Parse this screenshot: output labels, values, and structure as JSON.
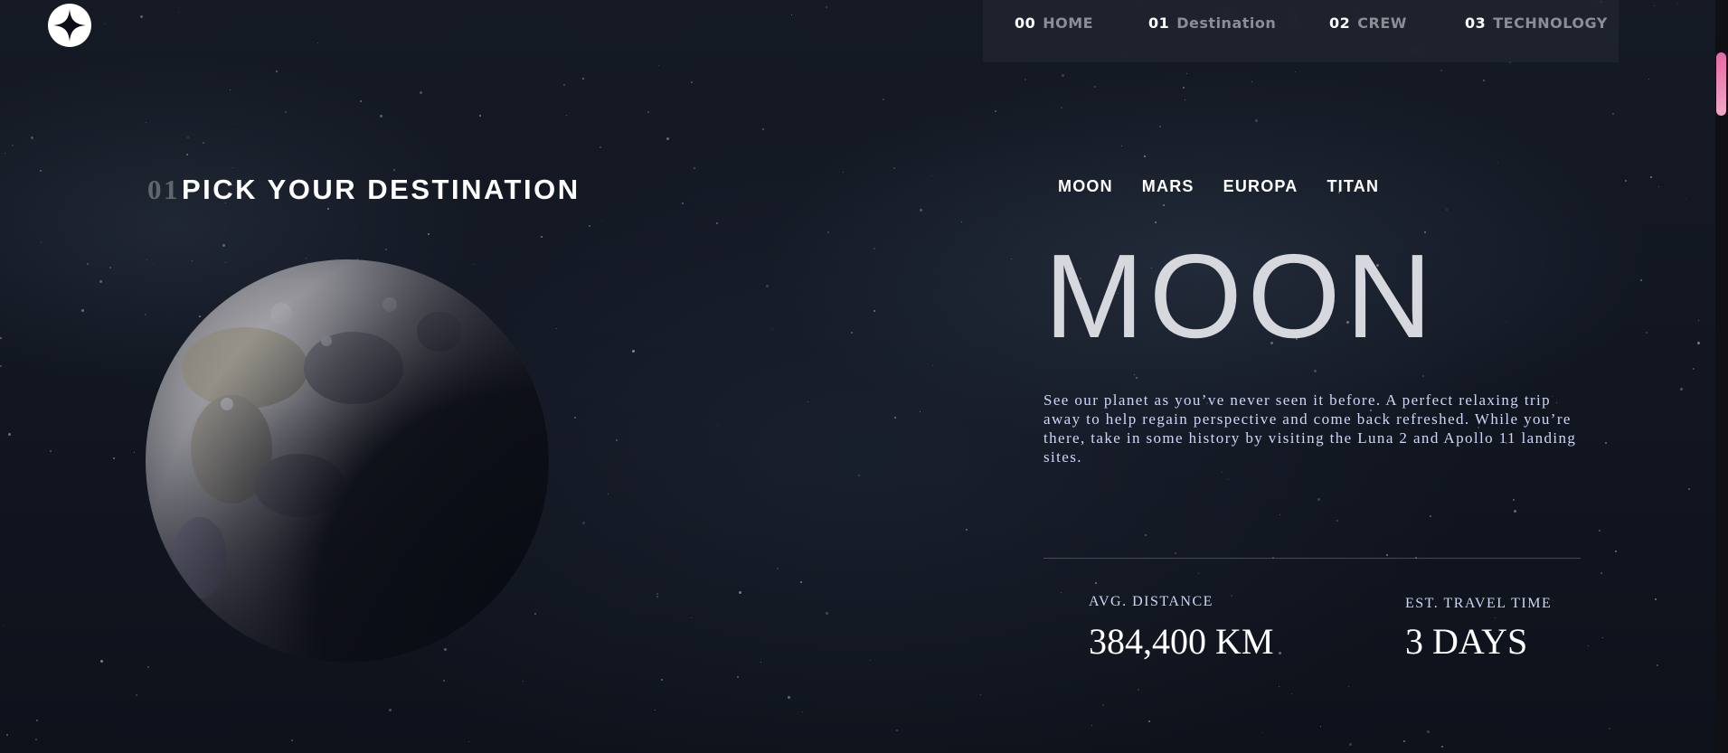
{
  "logo": {
    "icon": "star-logo-icon"
  },
  "nav": {
    "items": [
      {
        "num": "00",
        "label": "HOME"
      },
      {
        "num": "01",
        "label": "Destination"
      },
      {
        "num": "02",
        "label": "CREW"
      },
      {
        "num": "03",
        "label": "TECHNOLOGY"
      }
    ]
  },
  "heading": {
    "num": "01",
    "title": "PICK YOUR DESTINATION"
  },
  "tabs": [
    "MOON",
    "MARS",
    "EUROPA",
    "TITAN"
  ],
  "planet": {
    "name": "MOON",
    "description": "See our planet as you’ve never seen it before. A perfect relaxing trip away to help regain perspective and come back refreshed. While you’re there, take in some history by visiting the Luna 2 and Apollo 11 landing sites.",
    "image_icon": "moon-image"
  },
  "stats": {
    "distance_label": "AVG. DISTANCE",
    "distance_value": "384,400 KM",
    "travel_label": "EST. TRAVEL TIME",
    "travel_value": "3 DAYS"
  },
  "colors": {
    "background": "#0b0d17",
    "accent_light": "#d0d6f9",
    "scroll_thumb": "#e86aa4"
  }
}
